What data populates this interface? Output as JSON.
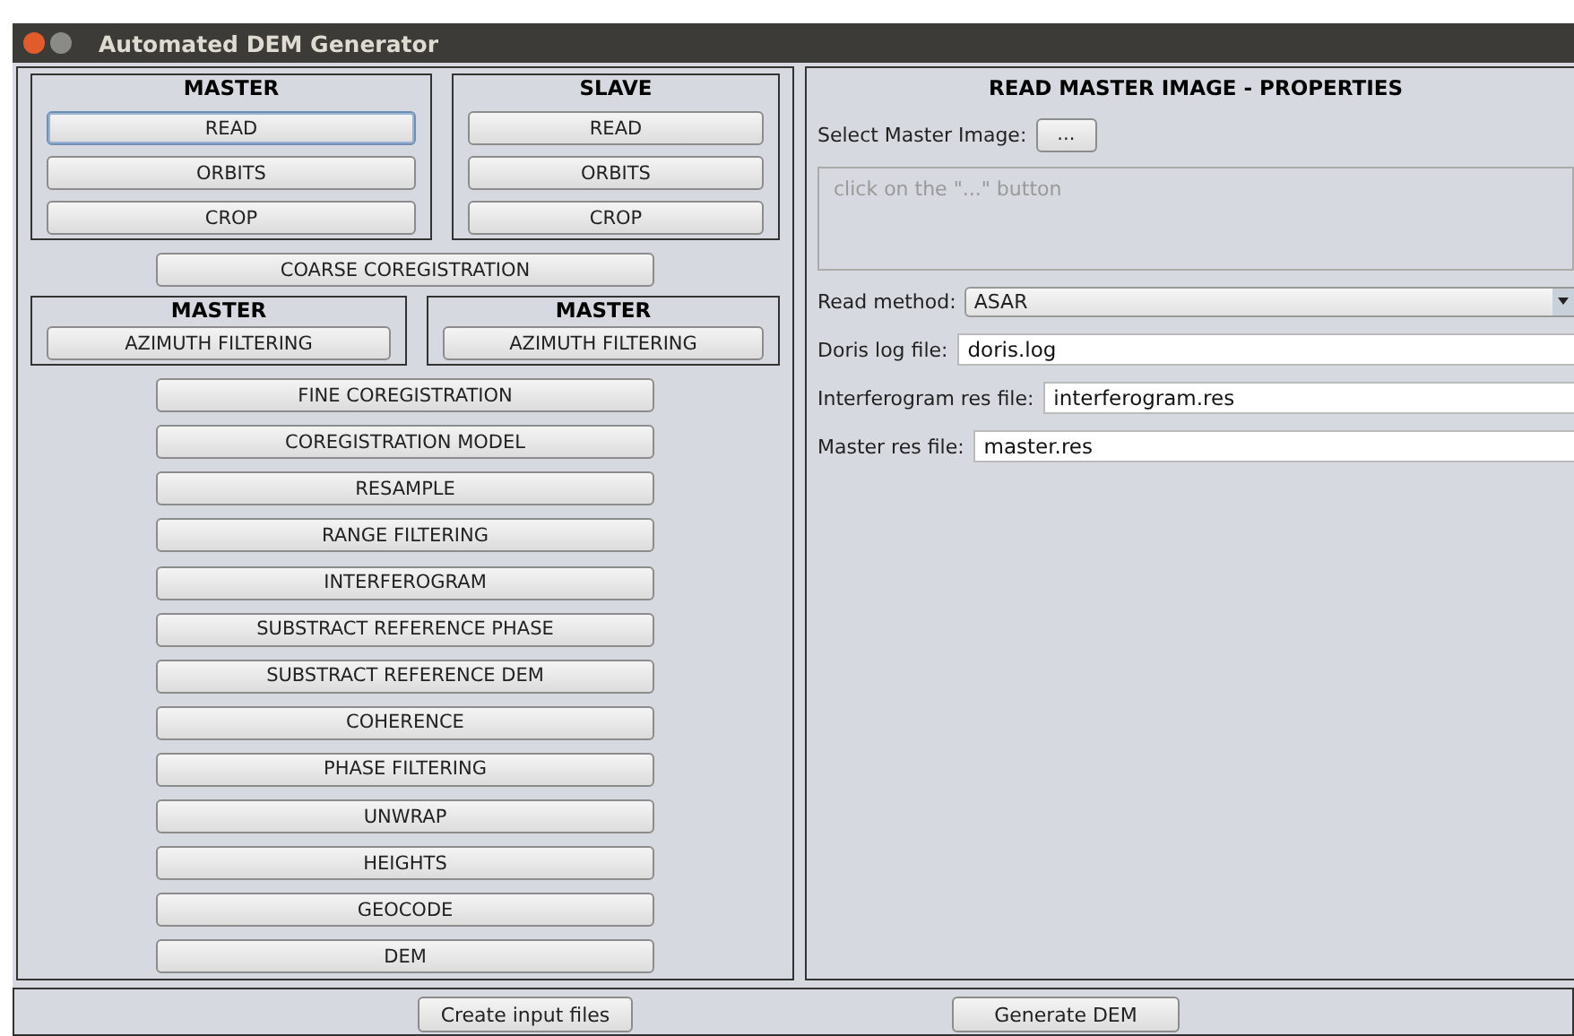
{
  "window": {
    "title": "Automated DEM Generator"
  },
  "top_groups": [
    {
      "title": "MASTER",
      "buttons": [
        {
          "label": "READ",
          "focused": true
        },
        {
          "label": "ORBITS",
          "focused": false
        },
        {
          "label": "CROP",
          "focused": false
        }
      ]
    },
    {
      "title": "SLAVE",
      "buttons": [
        {
          "label": "READ",
          "focused": false
        },
        {
          "label": "ORBITS",
          "focused": false
        },
        {
          "label": "CROP",
          "focused": false
        }
      ]
    }
  ],
  "coarse_button": "COARSE COREGISTRATION",
  "filter_groups": [
    {
      "title": "MASTER",
      "button": "AZIMUTH FILTERING"
    },
    {
      "title": "MASTER",
      "button": "AZIMUTH FILTERING"
    }
  ],
  "steps": [
    "FINE COREGISTRATION",
    "COREGISTRATION MODEL",
    "RESAMPLE",
    "RANGE FILTERING",
    "INTERFEROGRAM",
    "SUBSTRACT REFERENCE PHASE",
    "SUBSTRACT REFERENCE DEM",
    "COHERENCE",
    "PHASE FILTERING",
    "UNWRAP",
    "HEIGHTS",
    "GEOCODE",
    "DEM"
  ],
  "properties": {
    "title": "READ MASTER IMAGE - PROPERTIES",
    "select_label": "Select Master Image:",
    "browse_button": "...",
    "info_placeholder": "click on the \"...\" button",
    "read_method": {
      "label": "Read method:",
      "value": "ASAR"
    },
    "fields": [
      {
        "label": "Doris log file:",
        "value": "doris.log"
      },
      {
        "label": "Interferogram res file:",
        "value": "interferogram.res"
      },
      {
        "label": "Master res file:",
        "value": "master.res"
      }
    ]
  },
  "bottom_buttons": [
    "Create input files",
    "Generate DEM"
  ]
}
